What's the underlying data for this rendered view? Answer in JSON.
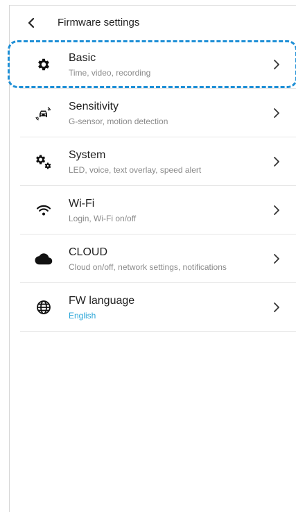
{
  "header": {
    "back_icon": "chevron-left-icon",
    "title": "Firmware settings"
  },
  "items": [
    {
      "id": "basic",
      "icon": "gear-icon",
      "label": "Basic",
      "sub": "Time, video, recording"
    },
    {
      "id": "sensitivity",
      "icon": "car-sensor-icon",
      "label": "Sensitivity",
      "sub": "G-sensor, motion detection"
    },
    {
      "id": "system",
      "icon": "gears-icon",
      "label": "System",
      "sub": "LED, voice, text overlay, speed alert"
    },
    {
      "id": "wifi",
      "icon": "wifi-icon",
      "label": "Wi-Fi",
      "sub": "Login, Wi-Fi on/off"
    },
    {
      "id": "cloud",
      "icon": "cloud-icon",
      "label": "CLOUD",
      "sub": "Cloud on/off, network settings, notifications"
    },
    {
      "id": "fw-language",
      "icon": "globe-icon",
      "label": "FW language",
      "sub": "English",
      "sub_color": "#2aa6d8"
    }
  ],
  "highlight_color": "#1e8fd6"
}
